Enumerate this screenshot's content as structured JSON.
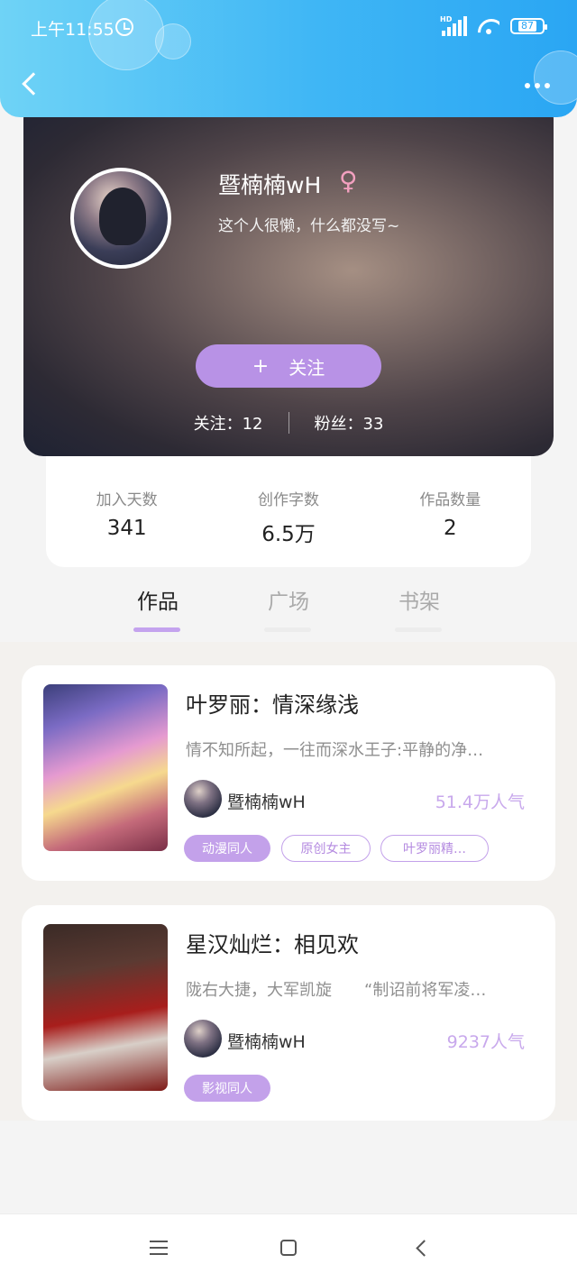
{
  "status_bar": {
    "time": "上午11:55",
    "signal_label": "HD",
    "battery": "87"
  },
  "profile": {
    "name": "暨楠楠wH",
    "gender_symbol": "♀",
    "bio": "这个人很懒，什么都没写~",
    "follow_button": "关注",
    "following": "关注：12",
    "followers": "粉丝：33"
  },
  "stats": [
    {
      "label": "加入天数",
      "value": "341"
    },
    {
      "label": "创作字数",
      "value": "6.5万"
    },
    {
      "label": "作品数量",
      "value": "2"
    }
  ],
  "tabs": [
    {
      "label": "作品",
      "active": true
    },
    {
      "label": "广场",
      "active": false
    },
    {
      "label": "书架",
      "active": false
    }
  ],
  "works": [
    {
      "title": "叶罗丽：情深缘浅",
      "desc": "情不知所起，一往而深水王子:平静的净…",
      "author": "暨楠楠wH",
      "popularity": "51.4万人气",
      "tags": [
        "动漫同人",
        "原创女主",
        "叶罗丽精…"
      ]
    },
    {
      "title": "星汉灿烂：相见欢",
      "desc": "陇右大捷，大军凯旋　　“制诏前将军凌…",
      "author": "暨楠楠wH",
      "popularity": "9237人气",
      "tags": [
        "影视同人"
      ]
    }
  ],
  "colors": {
    "accent": "#c3a1ea",
    "header": "#3fb6f5",
    "popularity": "#c8a8ec"
  },
  "icons": [
    "back-icon",
    "more-icon",
    "female-icon",
    "plus-icon",
    "menu-icon",
    "home-icon",
    "nav-back-icon"
  ]
}
